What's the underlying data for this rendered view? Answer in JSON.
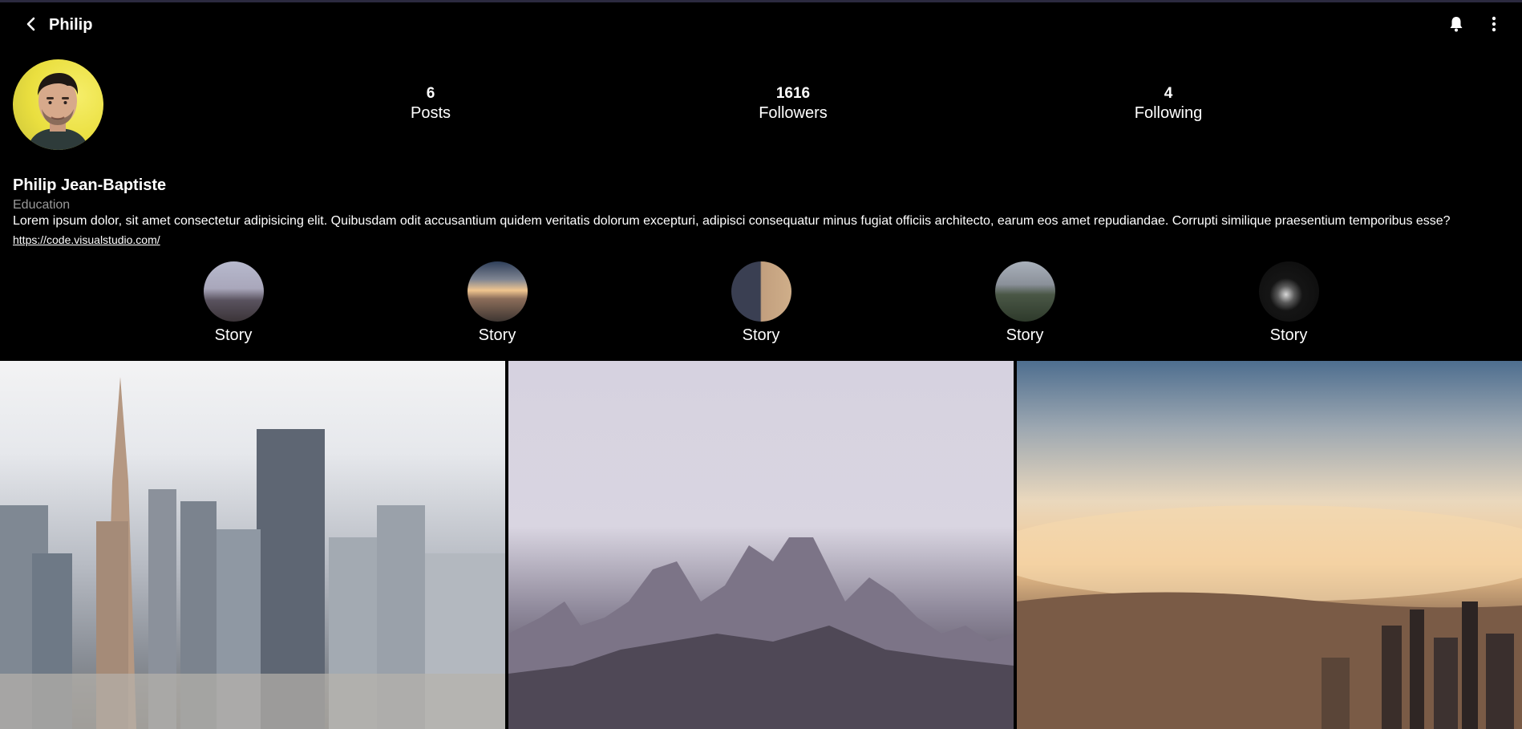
{
  "header": {
    "title": "Philip"
  },
  "profile": {
    "stats": [
      {
        "value": "6",
        "label": "Posts"
      },
      {
        "value": "1616",
        "label": "Followers"
      },
      {
        "value": "4",
        "label": "Following"
      }
    ],
    "name": "Philip Jean-Baptiste",
    "category": "Education",
    "bio": "Lorem ipsum dolor, sit amet consectetur adipisicing elit. Quibusdam odit accusantium quidem veritatis dolorum excepturi, adipisci consequatur minus fugiat officiis architecto, earum eos amet repudiandae. Corrupti similique praesentium temporibus esse?",
    "link": "https://code.visualstudio.com/"
  },
  "stories": [
    {
      "label": "Story"
    },
    {
      "label": "Story"
    },
    {
      "label": "Story"
    },
    {
      "label": "Story"
    },
    {
      "label": "Story"
    }
  ],
  "icons": {
    "back": "chevron-left-icon",
    "notifications": "bell-icon",
    "more": "more-vertical-icon"
  },
  "colors": {
    "background": "#000000",
    "text": "#ffffff",
    "muted": "#9a9a9a",
    "avatar_bg": "#eadf3f"
  }
}
